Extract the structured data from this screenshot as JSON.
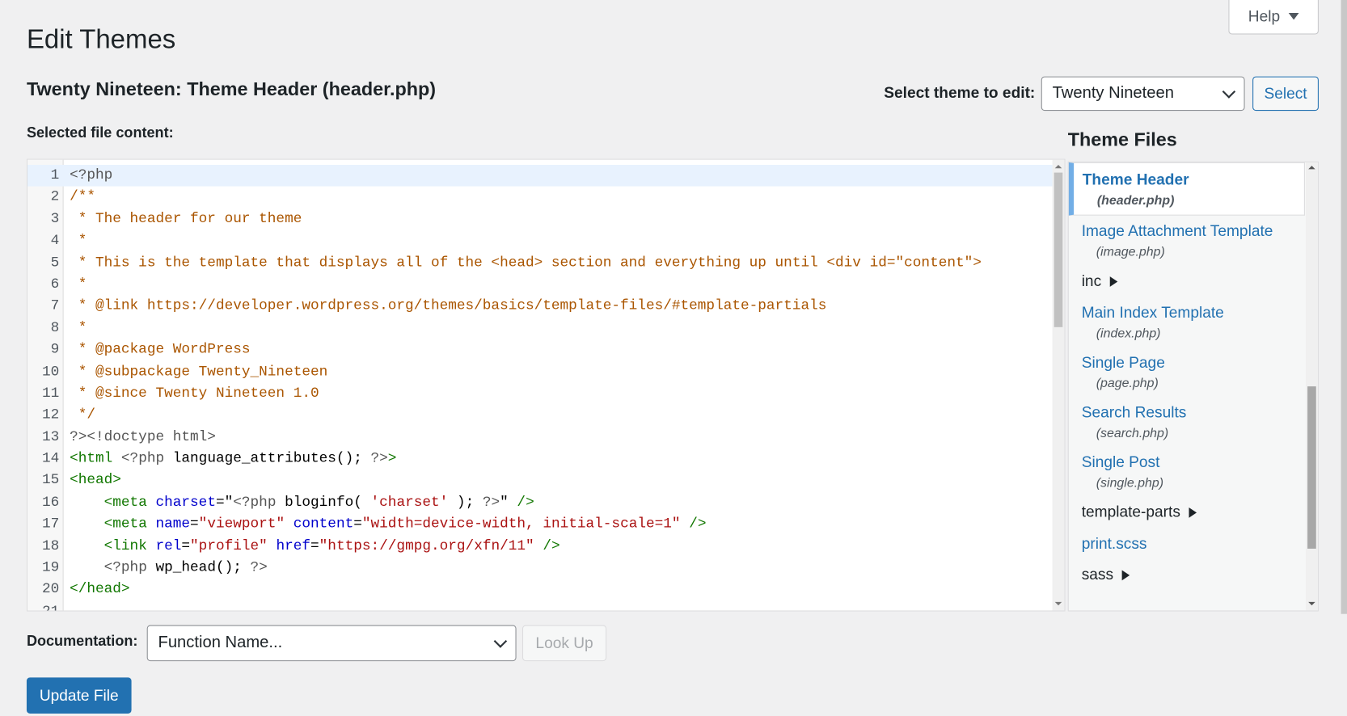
{
  "help": {
    "label": "Help"
  },
  "page": {
    "title": "Edit Themes",
    "subtitle": "Twenty Nineteen: Theme Header (header.php)",
    "content_label": "Selected file content:"
  },
  "theme_select": {
    "label": "Select theme to edit:",
    "value": "Twenty Nineteen",
    "button": "Select"
  },
  "files": {
    "title": "Theme Files",
    "items": [
      {
        "name": "Theme Header",
        "file": "(header.php)",
        "active": true
      },
      {
        "name": "Image Attachment Template",
        "file": "(image.php)"
      },
      {
        "folder": "inc"
      },
      {
        "name": "Main Index Template",
        "file": "(index.php)"
      },
      {
        "name": "Single Page",
        "file": "(page.php)"
      },
      {
        "name": "Search Results",
        "file": "(search.php)"
      },
      {
        "name": "Single Post",
        "file": "(single.php)"
      },
      {
        "folder": "template-parts"
      },
      {
        "name": "print.scss"
      },
      {
        "folder": "sass"
      }
    ]
  },
  "editor": {
    "active_line": 1,
    "lines": [
      [
        [
          "<?php",
          "meta"
        ]
      ],
      [
        [
          "/**",
          "comment"
        ]
      ],
      [
        [
          " * The header for our theme",
          "comment"
        ]
      ],
      [
        [
          " *",
          "comment"
        ]
      ],
      [
        [
          " * This is the template that displays all of the <head> section and everything up until <div id=\"content\">",
          "comment"
        ]
      ],
      [
        [
          " *",
          "comment"
        ]
      ],
      [
        [
          " * @link https://developer.wordpress.org/themes/basics/template-files/#template-partials",
          "comment"
        ]
      ],
      [
        [
          " *",
          "comment"
        ]
      ],
      [
        [
          " * @package WordPress",
          "comment"
        ]
      ],
      [
        [
          " * @subpackage Twenty_Nineteen",
          "comment"
        ]
      ],
      [
        [
          " * @since Twenty Nineteen 1.0",
          "comment"
        ]
      ],
      [
        [
          " */",
          "comment"
        ]
      ],
      [
        [
          "?><!doctype html>",
          "meta"
        ]
      ],
      [
        [
          "<html",
          "tag"
        ],
        [
          " <?php ",
          "meta"
        ],
        [
          "language_attributes",
          "plain"
        ],
        [
          "(); ",
          "plain"
        ],
        [
          "?>",
          "meta"
        ],
        [
          ">",
          "tag"
        ]
      ],
      [
        [
          "<head>",
          "tag"
        ]
      ],
      [
        [
          "    ",
          "plain"
        ],
        [
          "<meta",
          "tag"
        ],
        [
          " ",
          "plain"
        ],
        [
          "charset",
          "attr"
        ],
        [
          "=\"",
          "plain"
        ],
        [
          "<?php ",
          "meta"
        ],
        [
          "bloginfo",
          "plain"
        ],
        [
          "( ",
          "plain"
        ],
        [
          "'charset'",
          "string"
        ],
        [
          " ); ",
          "plain"
        ],
        [
          "?>",
          "meta"
        ],
        [
          "\" ",
          "plain"
        ],
        [
          "/>",
          "tag"
        ]
      ],
      [
        [
          "    ",
          "plain"
        ],
        [
          "<meta",
          "tag"
        ],
        [
          " ",
          "plain"
        ],
        [
          "name",
          "attr"
        ],
        [
          "=",
          "plain"
        ],
        [
          "\"viewport\"",
          "string"
        ],
        [
          " ",
          "plain"
        ],
        [
          "content",
          "attr"
        ],
        [
          "=",
          "plain"
        ],
        [
          "\"width=device-width, initial-scale=1\"",
          "string"
        ],
        [
          " ",
          "plain"
        ],
        [
          "/>",
          "tag"
        ]
      ],
      [
        [
          "    ",
          "plain"
        ],
        [
          "<link",
          "tag"
        ],
        [
          " ",
          "plain"
        ],
        [
          "rel",
          "attr"
        ],
        [
          "=",
          "plain"
        ],
        [
          "\"profile\"",
          "string"
        ],
        [
          " ",
          "plain"
        ],
        [
          "href",
          "attr"
        ],
        [
          "=",
          "plain"
        ],
        [
          "\"https://gmpg.org/xfn/11\"",
          "string"
        ],
        [
          " ",
          "plain"
        ],
        [
          "/>",
          "tag"
        ]
      ],
      [
        [
          "    ",
          "plain"
        ],
        [
          "<?php ",
          "meta"
        ],
        [
          "wp_head",
          "plain"
        ],
        [
          "(); ",
          "plain"
        ],
        [
          "?>",
          "meta"
        ]
      ],
      [
        [
          "</head>",
          "tag"
        ]
      ],
      []
    ]
  },
  "documentation": {
    "label": "Documentation:",
    "placeholder": "Function Name...",
    "lookup": "Look Up"
  },
  "update_button": "Update File",
  "colors": {
    "accent": "#2271b1",
    "active_file_border": "#72aee6",
    "comment": "#aa5500",
    "tag": "#117700",
    "attribute": "#0000cc",
    "string": "#aa1111"
  }
}
